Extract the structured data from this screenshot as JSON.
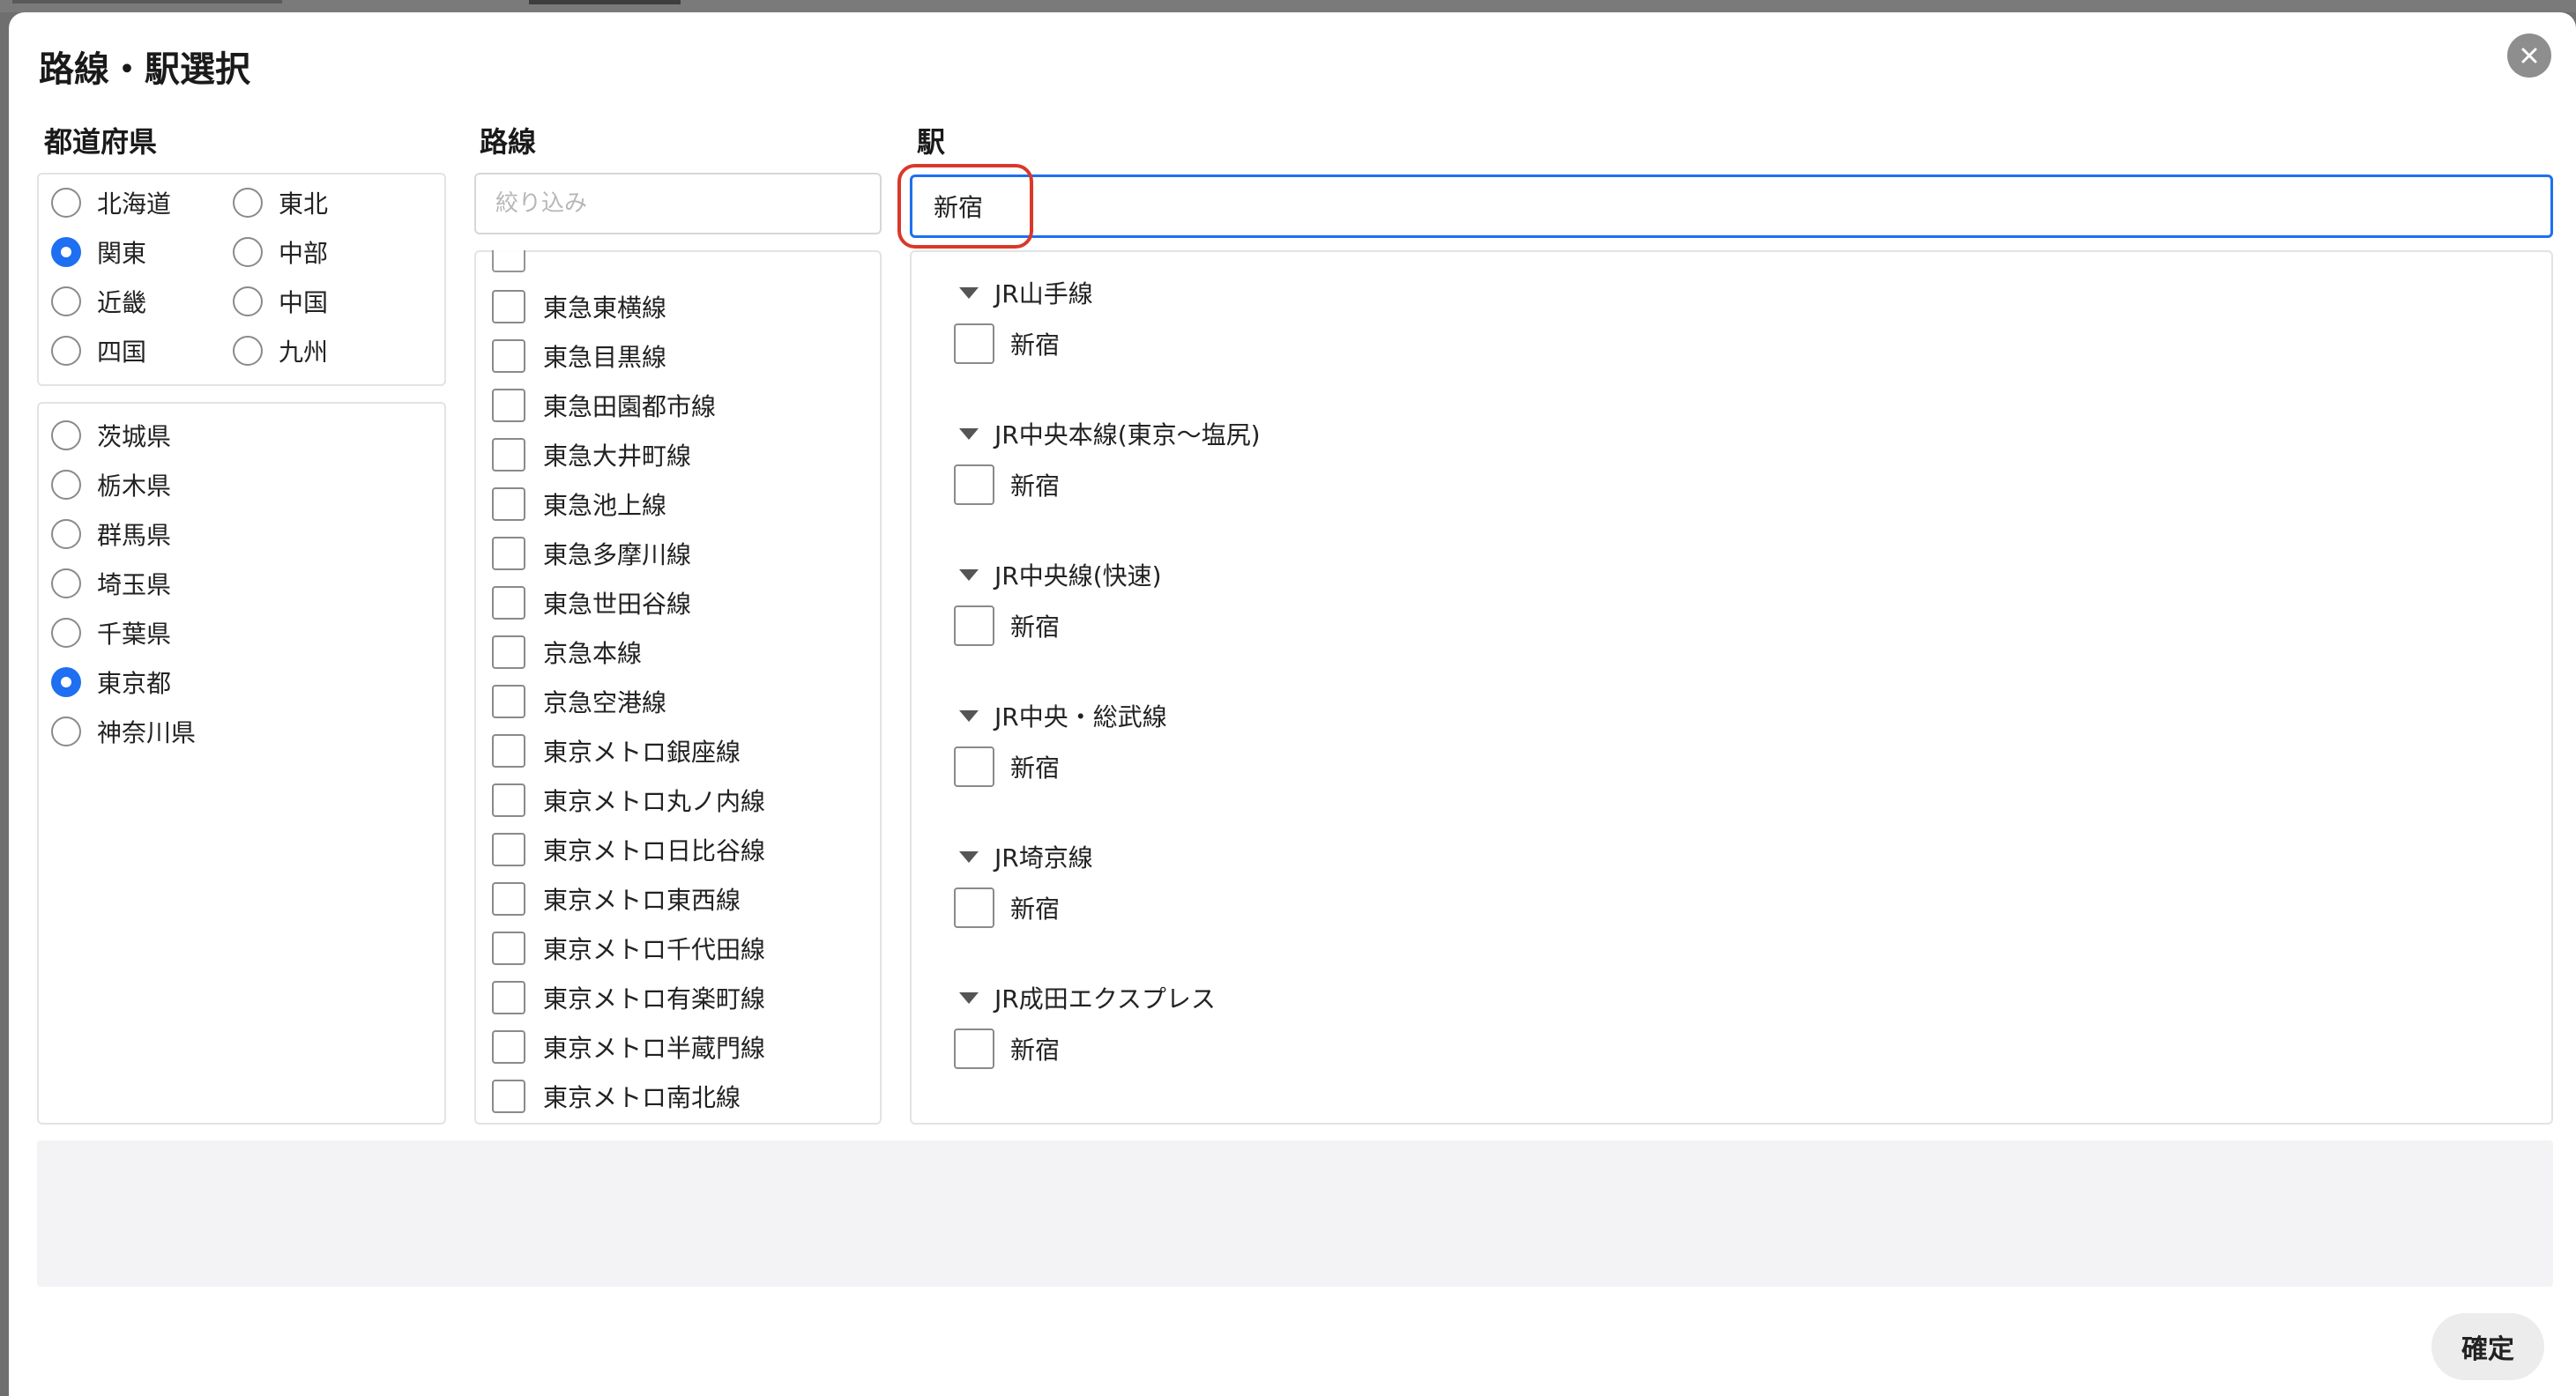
{
  "dialog": {
    "title": "路線・駅選択"
  },
  "columns": {
    "prefecture": "都道府県",
    "line": "路線",
    "station": "駅"
  },
  "regions": [
    {
      "label": "北海道",
      "checked": false
    },
    {
      "label": "東北",
      "checked": false
    },
    {
      "label": "関東",
      "checked": true
    },
    {
      "label": "中部",
      "checked": false
    },
    {
      "label": "近畿",
      "checked": false
    },
    {
      "label": "中国",
      "checked": false
    },
    {
      "label": "四国",
      "checked": false
    },
    {
      "label": "九州",
      "checked": false
    }
  ],
  "prefectures": [
    {
      "label": "茨城県",
      "checked": false
    },
    {
      "label": "栃木県",
      "checked": false
    },
    {
      "label": "群馬県",
      "checked": false
    },
    {
      "label": "埼玉県",
      "checked": false
    },
    {
      "label": "千葉県",
      "checked": false
    },
    {
      "label": "東京都",
      "checked": true
    },
    {
      "label": "神奈川県",
      "checked": false
    }
  ],
  "line_filter": {
    "placeholder": "絞り込み",
    "value": ""
  },
  "lines": [
    "東急東横線",
    "東急目黒線",
    "東急田園都市線",
    "東急大井町線",
    "東急池上線",
    "東急多摩川線",
    "東急世田谷線",
    "京急本線",
    "京急空港線",
    "東京メトロ銀座線",
    "東京メトロ丸ノ内線",
    "東京メトロ日比谷線",
    "東京メトロ東西線",
    "東京メトロ千代田線",
    "東京メトロ有楽町線",
    "東京メトロ半蔵門線",
    "東京メトロ南北線"
  ],
  "station_search": {
    "value": "新宿"
  },
  "station_groups": [
    {
      "line": "JR山手線",
      "station": "新宿"
    },
    {
      "line": "JR中央本線(東京〜塩尻)",
      "station": "新宿"
    },
    {
      "line": "JR中央線(快速)",
      "station": "新宿"
    },
    {
      "line": "JR中央・総武線",
      "station": "新宿"
    },
    {
      "line": "JR埼京線",
      "station": "新宿"
    },
    {
      "line": "JR成田エクスプレス",
      "station": "新宿"
    }
  ],
  "footer": {
    "confirm_label": "確定"
  },
  "colors": {
    "accent": "#1e6ff1",
    "highlight": "#d9382b"
  }
}
